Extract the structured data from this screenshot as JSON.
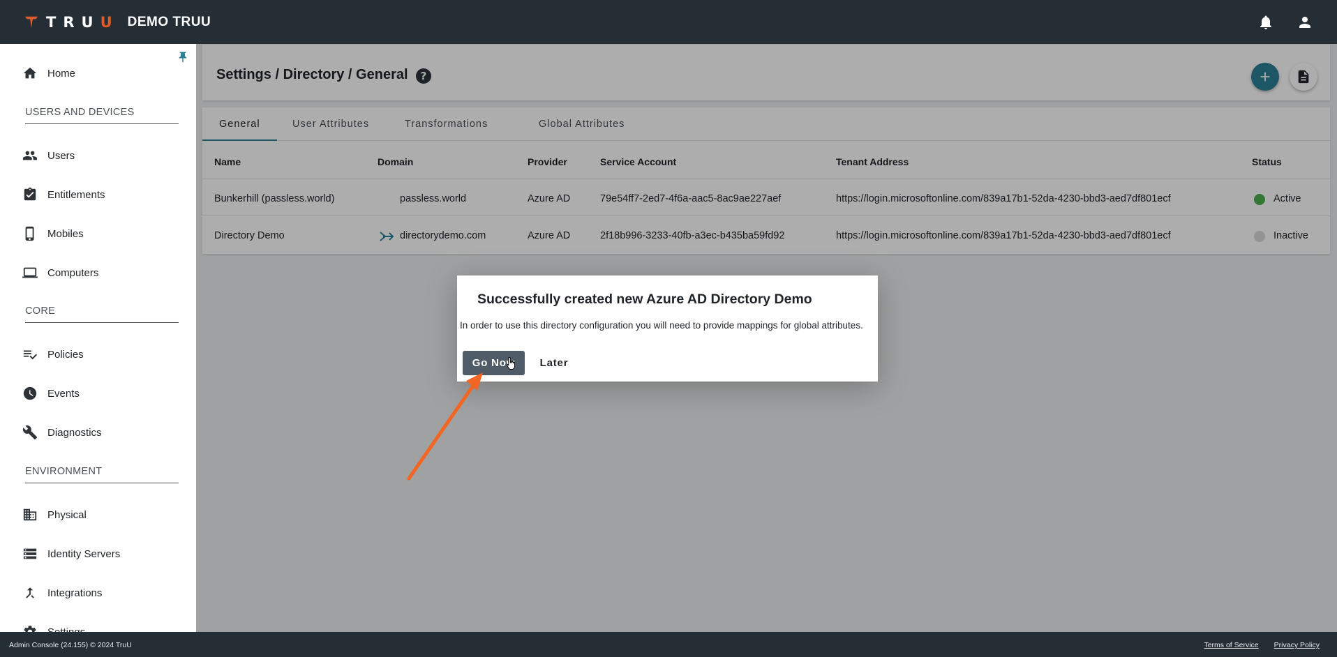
{
  "app": {
    "logo_letters": "TRU",
    "logo_accent": "U",
    "title": "DEMO TRUU",
    "brand_color": "#e15a27",
    "accent_color": "#2b7f96"
  },
  "sidebar": {
    "items": [
      {
        "label": "Home",
        "icon": "home-icon"
      },
      {
        "label": "Users",
        "icon": "users-icon"
      },
      {
        "label": "Entitlements",
        "icon": "clipboard-check-icon"
      },
      {
        "label": "Mobiles",
        "icon": "mobile-icon"
      },
      {
        "label": "Computers",
        "icon": "laptop-icon"
      },
      {
        "label": "Policies",
        "icon": "playlist-check-icon"
      },
      {
        "label": "Events",
        "icon": "clock-icon"
      },
      {
        "label": "Diagnostics",
        "icon": "wrench-icon"
      },
      {
        "label": "Physical",
        "icon": "building-icon"
      },
      {
        "label": "Identity Servers",
        "icon": "server-list-icon"
      },
      {
        "label": "Integrations",
        "icon": "merge-icon"
      },
      {
        "label": "Settings",
        "icon": "gear-icon"
      }
    ],
    "sections": [
      "USERS AND DEVICES",
      "CORE",
      "ENVIRONMENT"
    ]
  },
  "header": {
    "breadcrumb": "Settings / Directory / General"
  },
  "tabs": [
    "General",
    "User Attributes",
    "Transformations",
    "Global Attributes"
  ],
  "table": {
    "columns": [
      "Name",
      "Domain",
      "Provider",
      "Service Account",
      "Tenant Address",
      "Status"
    ],
    "rows": [
      {
        "name": "Bunkerhill (passless.world)",
        "domain": "passless.world",
        "provider": "Azure AD",
        "service_account": "79e54ff7-2ed7-4f6a-aac5-8ac9ae227aef",
        "tenant_address": "https://login.microsoftonline.com/839a17b1-52da-4230-bbd3-aed7df801ecf",
        "status": "Active",
        "status_color": "#4caf50"
      },
      {
        "name": "Directory Demo",
        "domain": "directorydemo.com",
        "provider": "Azure AD",
        "service_account": "2f18b996-3233-40fb-a3ec-b435ba59fd92",
        "tenant_address": "https://login.microsoftonline.com/839a17b1-52da-4230-bbd3-aed7df801ecf",
        "status": "Inactive",
        "status_color": "#d9d9d9"
      }
    ]
  },
  "dialog": {
    "title": "Successfully created new Azure AD Directory Demo",
    "message": "In order to use this directory configuration you will need to provide mappings for global attributes.",
    "primary_button": "Go Now",
    "secondary_button": "Later",
    "annotation_arrow_color": "#f26522"
  },
  "footer": {
    "copyright": "Admin Console (24.155) © 2024 TruU",
    "links": [
      "Terms of Service",
      "Privacy Policy"
    ]
  }
}
